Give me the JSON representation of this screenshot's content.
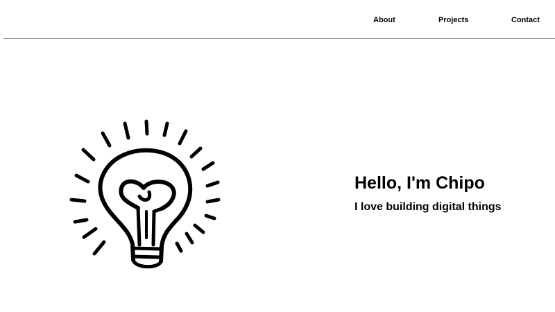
{
  "nav": {
    "links": [
      {
        "label": "About"
      },
      {
        "label": "Projects"
      },
      {
        "label": "Contact"
      }
    ]
  },
  "hero": {
    "illustration_icon": "lightbulb-icon",
    "title": "Hello, I'm Chipo",
    "subtitle": "I love building digital things"
  },
  "colors": {
    "background": "#ffffff",
    "text": "#000000",
    "divider": "#9a9a9a"
  }
}
